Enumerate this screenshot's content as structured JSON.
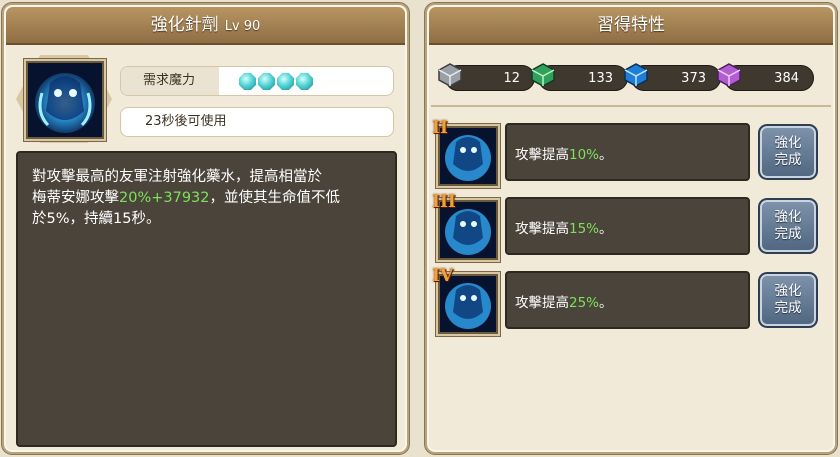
{
  "left_panel": {
    "title": "強化針劑",
    "level": "Lv 90",
    "mana_label": "需求魔力",
    "mana_gems": 4,
    "cooldown_text": "23秒後可使用",
    "description_line1": "對攻擊最高的友軍注射強化藥水，提高相當於",
    "description_line2_a": "梅蒂安娜攻擊",
    "description_line2_hl": "20%+37932",
    "description_line2_b": "，並使其生命值不低",
    "description_line3": "於5%，持續15秒。"
  },
  "right_panel": {
    "title": "習得特性",
    "resources": [
      {
        "icon": "silver-book-icon",
        "value": "12"
      },
      {
        "icon": "green-book-icon",
        "value": "133"
      },
      {
        "icon": "blue-book-icon",
        "value": "373"
      },
      {
        "icon": "purple-book-icon",
        "value": "384"
      }
    ],
    "traits": [
      {
        "rank": "II",
        "text_a": "攻擊提高",
        "pct": "10%",
        "text_b": "。",
        "button": "強化\n完成"
      },
      {
        "rank": "III",
        "text_a": "攻擊提高",
        "pct": "15%",
        "text_b": "。",
        "button": "強化\n完成"
      },
      {
        "rank": "IV",
        "text_a": "攻擊提高",
        "pct": "25%",
        "text_b": "。",
        "button": "強化\n完成"
      }
    ]
  },
  "colors": {
    "highlight_green": "#7ee05a",
    "header_brown": "#8e6e43",
    "button_blue": "#5f7690"
  }
}
